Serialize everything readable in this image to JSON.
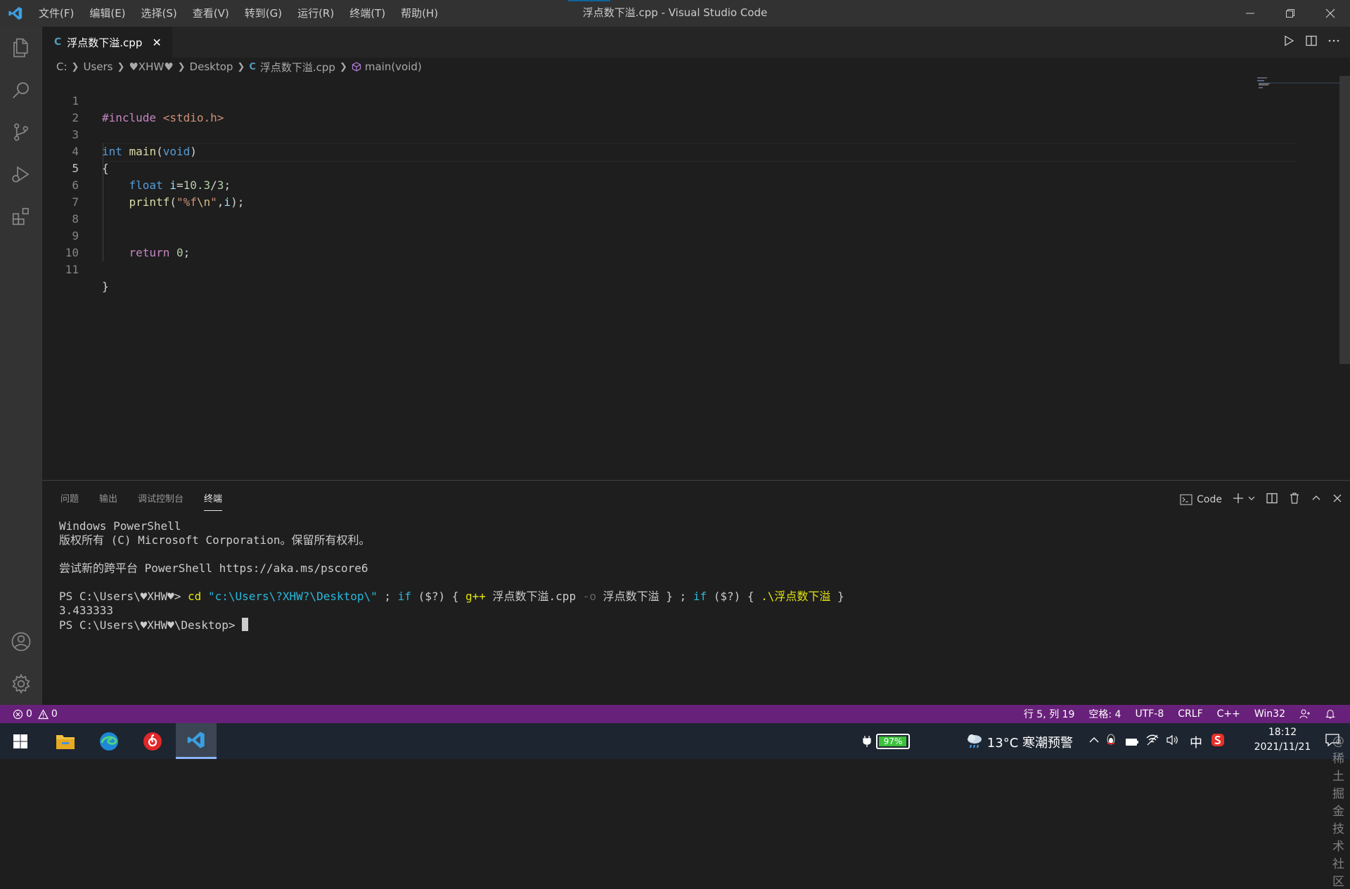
{
  "window": {
    "title": "浮点数下溢.cpp - Visual Studio Code",
    "menu": [
      "文件(F)",
      "编辑(E)",
      "选择(S)",
      "查看(V)",
      "转到(G)",
      "运行(R)",
      "终端(T)",
      "帮助(H)"
    ]
  },
  "tab": {
    "label": "浮点数下溢.cpp",
    "close": "✕",
    "lang_badge": "C"
  },
  "breadcrumb": {
    "items": [
      "C:",
      "Users",
      "♥XHW♥",
      "Desktop",
      "浮点数下溢.cpp",
      "main(void)"
    ]
  },
  "editor": {
    "active_line": 5,
    "line_numbers": [
      "1",
      "2",
      "3",
      "4",
      "5",
      "6",
      "7",
      "8",
      "9",
      "10",
      "11"
    ]
  },
  "panel": {
    "tabs": [
      "问题",
      "输出",
      "调试控制台",
      "终端"
    ],
    "active_tab": "终端",
    "terminal_selector": "Code",
    "terminal": {
      "line1": "Windows PowerShell",
      "line2": "版权所有 (C) Microsoft Corporation。保留所有权利。",
      "line3": "尝试新的跨平台 PowerShell https://aka.ms/pscore6",
      "prompt1": "PS C:\\Users\\♥XHW♥> ",
      "cmd_cd": "cd ",
      "cmd_path": "\"c:\\Users\\?XHW?\\Desktop\\\"",
      "cmd_semi1": " ; ",
      "cmd_if1": "if",
      "cmd_cond1": " ($?) ",
      "cmd_brace1": "{ ",
      "cmd_gpp": "g++",
      "cmd_file": " 浮点数下溢.cpp ",
      "cmd_o": "-o",
      "cmd_out": " 浮点数下溢 ",
      "cmd_brace1_close": "}",
      "cmd_semi2": " ; ",
      "cmd_if2": "if",
      "cmd_cond2": " ($?) ",
      "cmd_brace2": "{ ",
      "cmd_run": ".\\浮点数下溢",
      "cmd_brace2_close": " }",
      "output": "3.433333",
      "prompt2": "PS C:\\Users\\♥XHW♥\\Desktop> "
    }
  },
  "statusbar": {
    "errors": "0",
    "warnings": "0",
    "position": "行 5, 列 19",
    "spaces": "空格: 4",
    "encoding": "UTF-8",
    "eol": "CRLF",
    "language": "C++",
    "platform": "Win32",
    "color": "#68217a"
  },
  "taskbar": {
    "battery": "97%",
    "battery_level": 0.97,
    "weather": "13°C 寒潮预警",
    "ime": "中",
    "time": "18:12",
    "date": "2021/11/21",
    "watermark": "@稀土掘金技术社区"
  }
}
